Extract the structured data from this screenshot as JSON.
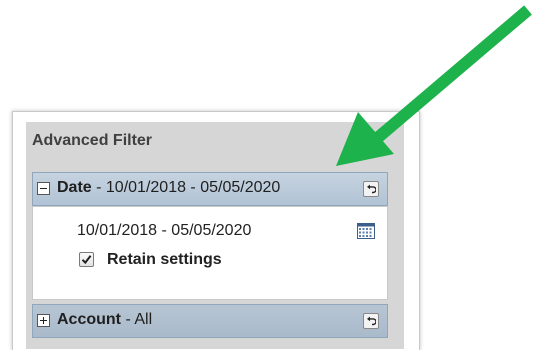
{
  "panel": {
    "title": "Advanced Filter"
  },
  "sections": [
    {
      "key": "Date",
      "summary": " - 10/01/2018 - 05/05/2020",
      "expanded": true,
      "date_range": "10/01/2018 - 05/05/2020",
      "retain_label": "Retain settings",
      "retain_checked": true
    },
    {
      "key": "Account",
      "summary": " - All",
      "expanded": false
    }
  ],
  "icons": {
    "collapse": "minus-box-icon",
    "expand": "plus-box-icon",
    "reset": "reset-icon",
    "calendar": "calendar-icon",
    "check": "check-icon"
  },
  "colors": {
    "arrow": "#1db24b",
    "header": "#b1c3d5",
    "panel_bg": "#d6d6d6"
  }
}
